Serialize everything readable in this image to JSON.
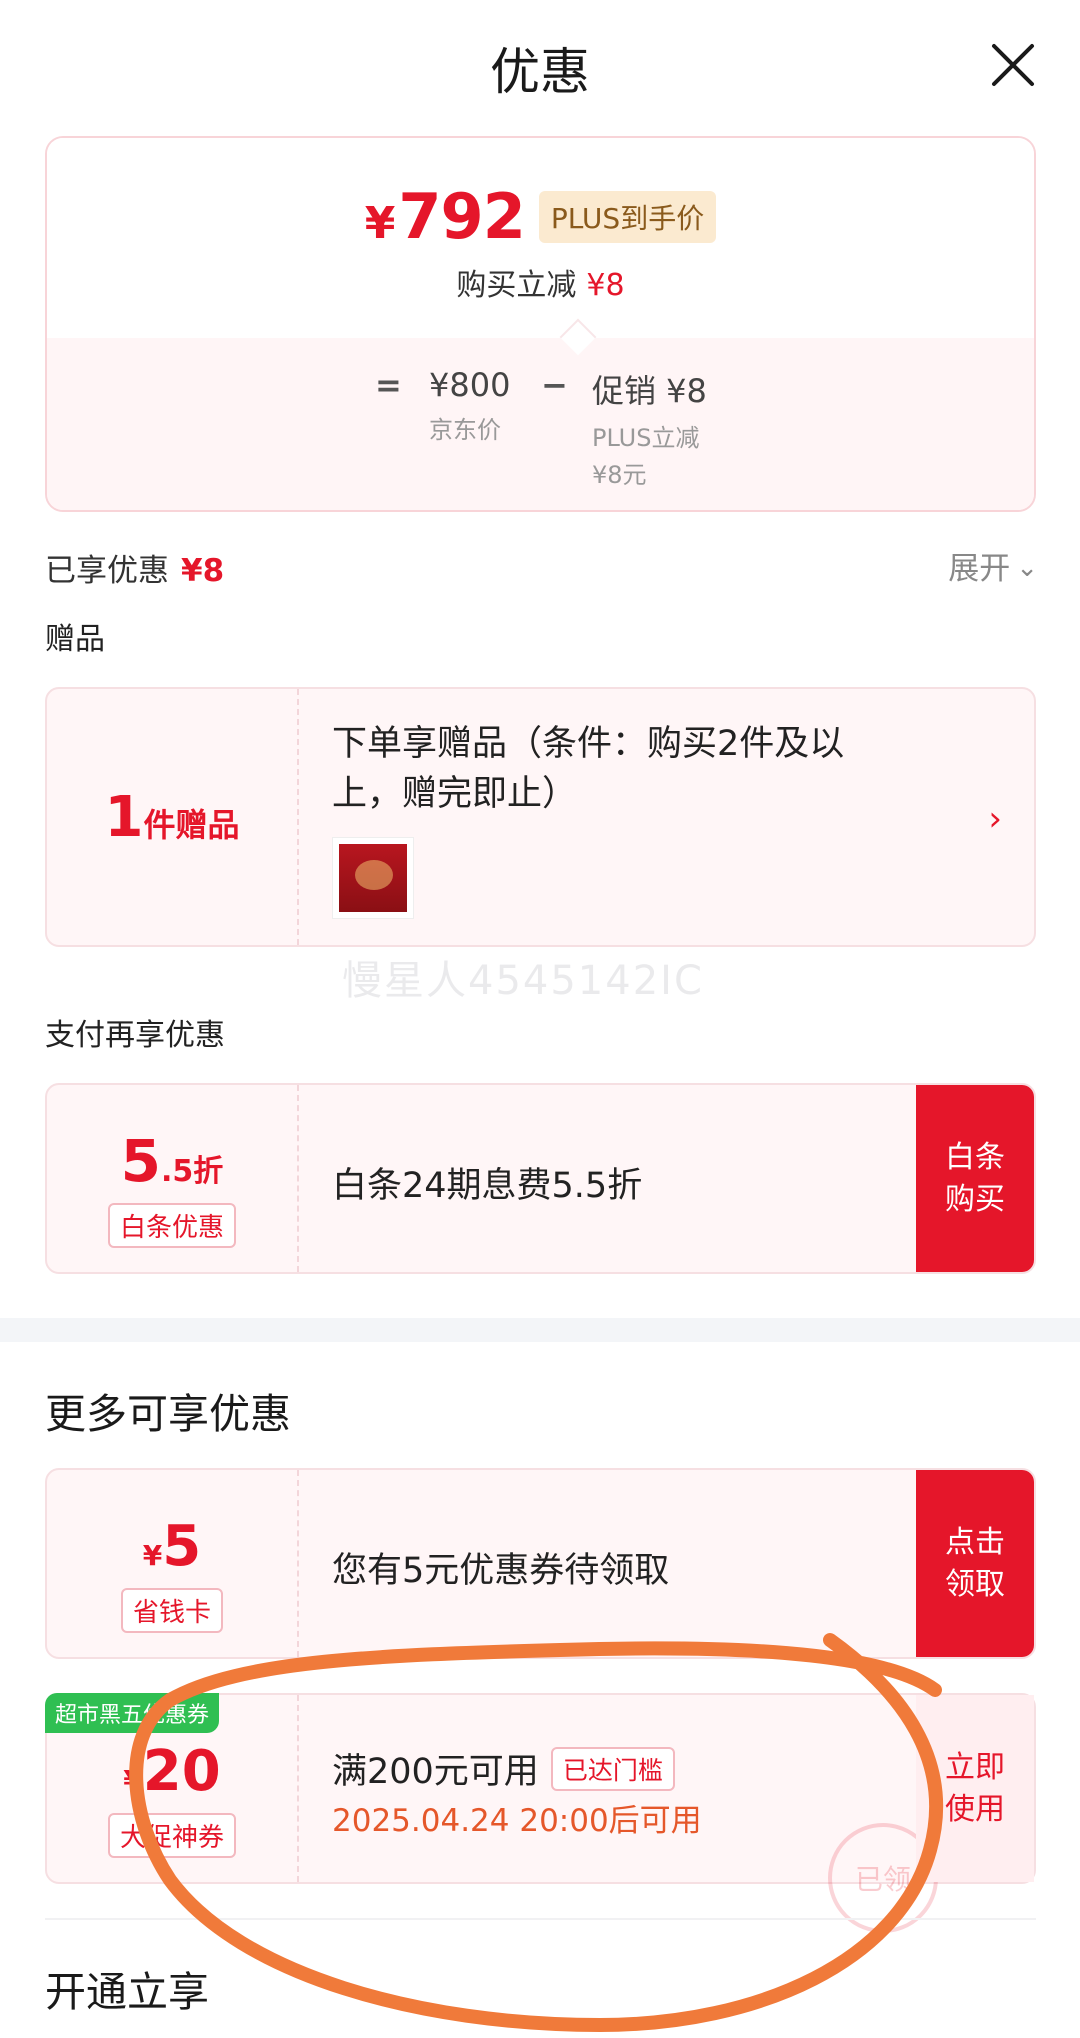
{
  "header": {
    "title": "优惠",
    "close_icon": "close-icon"
  },
  "price_card": {
    "final_price_symbol": "¥",
    "final_price": "792",
    "plus_tag": "PLUS到手价",
    "reduce_text": "购买立减",
    "reduce_amount": "¥8",
    "equals": "=",
    "jd_price": "¥800",
    "jd_price_label": "京东价",
    "minus": "−",
    "promo_label": "促销 ¥8",
    "promo_sub_1": "PLUS立减",
    "promo_sub_2": "¥8元"
  },
  "enjoyed": {
    "label": "已享优惠",
    "amount": "¥8",
    "expand": "展开"
  },
  "gift": {
    "section_label": "赠品",
    "count": "1",
    "unit": "件赠品",
    "description": "下单享赠品（条件：购买2件及以上，赠完即止）"
  },
  "watermark": "慢星人4545142IC",
  "pay": {
    "section_label": "支付再享优惠",
    "discount_big": "5",
    "discount_small": ".5折",
    "tag": "白条优惠",
    "description": "白条24期息费5.5折",
    "action": "白条\n购买"
  },
  "more": {
    "title": "更多可享优惠",
    "coupon": {
      "yen": "¥",
      "amount": "5",
      "tag": "省钱卡",
      "description": "您有5元优惠券待领取",
      "action": "点击\n领取"
    },
    "voucher": {
      "ribbon": "超市黑五优惠券",
      "yen": "¥",
      "amount": "20",
      "tag": "大促神券",
      "line1": "满200元可用",
      "threshold_tag": "已达门槛",
      "line2": "2025.04.24 20:00后可用",
      "action": "立即\n使用",
      "stamp": "已领"
    }
  },
  "open_section": {
    "title": "开通立享"
  },
  "colors": {
    "accent_red": "#e5162a",
    "scribble_orange": "#f07a3a",
    "ribbon_green": "#2fbf52"
  }
}
